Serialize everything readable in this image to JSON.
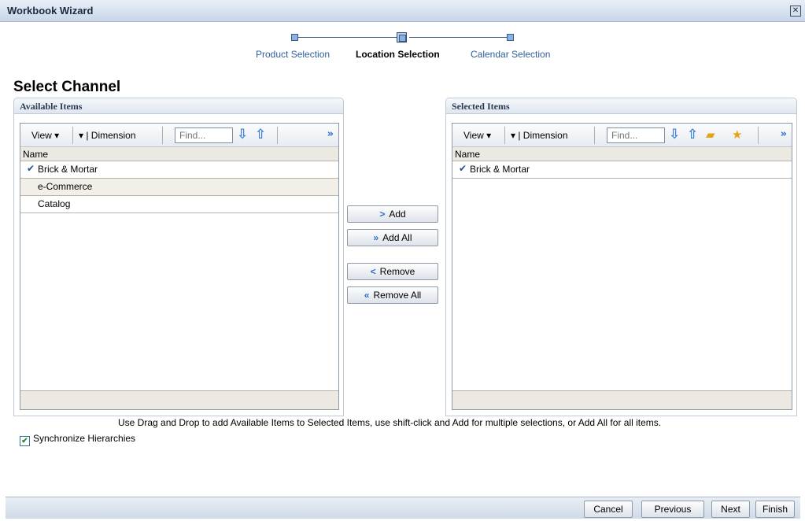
{
  "window": {
    "title": "Workbook Wizard"
  },
  "train": {
    "steps": [
      {
        "label": "Product Selection"
      },
      {
        "label": "Location Selection"
      },
      {
        "label": "Calendar Selection"
      }
    ]
  },
  "heading": "Select Channel",
  "available": {
    "title": "Available Items",
    "view_label": "View ▾",
    "dimension_label": "▾ | Dimension",
    "find_placeholder": "Find...",
    "column": "Name",
    "rows": [
      "Brick & Mortar",
      "e-Commerce",
      "Catalog"
    ]
  },
  "selected": {
    "title": "Selected Items",
    "view_label": "View ▾",
    "dimension_label": "▾ | Dimension",
    "find_placeholder": "Find...",
    "column": "Name",
    "rows": [
      "Brick & Mortar"
    ]
  },
  "buttons": {
    "add": "Add",
    "add_all": "Add All",
    "remove": "Remove",
    "remove_all": "Remove All"
  },
  "help_text": "Use Drag and Drop to add Available Items to Selected Items, use shift-click and Add for multiple selections, or Add All for all items.",
  "sync_label": "Synchronize Hierarchies",
  "footer": {
    "cancel": "Cancel",
    "previous": "Previous",
    "next": "Next",
    "finish": "Finish"
  }
}
